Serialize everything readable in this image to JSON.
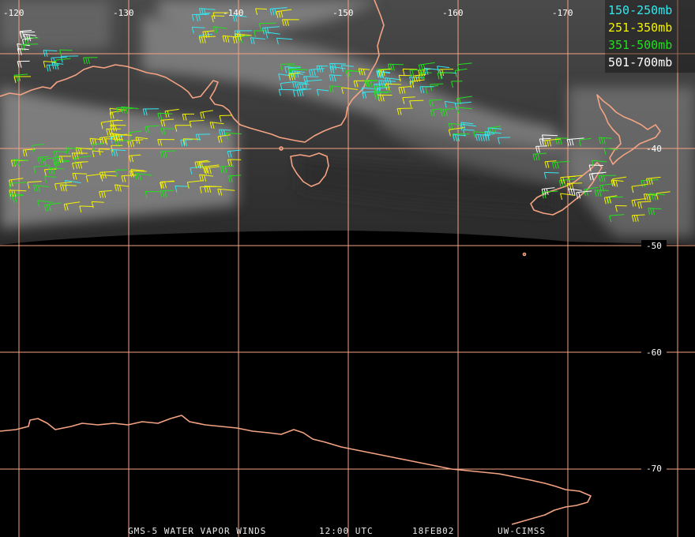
{
  "map": {
    "longitude_labels": [
      "-120",
      "-130",
      "-140",
      "-150",
      "-160",
      "-170"
    ],
    "latitude_labels": [
      "-40",
      "-50",
      "-60",
      "-70"
    ]
  },
  "legend": [
    {
      "label": "150-250mb",
      "color": "#33e8f0"
    },
    {
      "label": "251-350mb",
      "color": "#f4f400"
    },
    {
      "label": "351-500mb",
      "color": "#22e01e"
    },
    {
      "label": "501-700mb",
      "color": "#ffffff"
    }
  ],
  "footer": {
    "product": "GMS-5 WATER VAPOR WINDS",
    "time": "12:00 UTC",
    "date": "18FEB02",
    "source": "UW-CIMSS"
  },
  "colors": {
    "grid": "#f4a383",
    "coast": "#f4a383",
    "background": "#000000"
  }
}
